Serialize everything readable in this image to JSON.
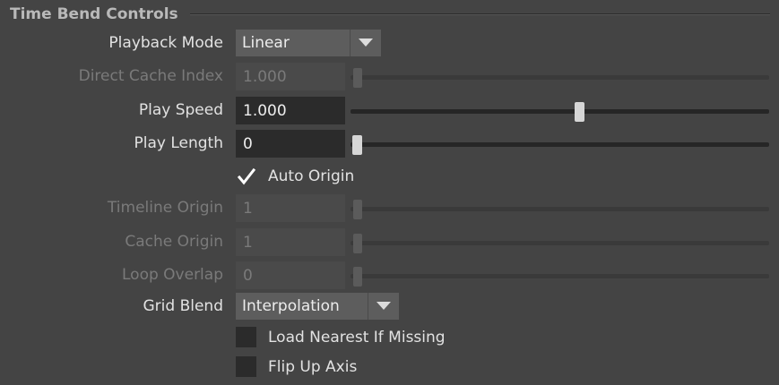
{
  "section": {
    "title": "Time Bend Controls"
  },
  "playback_mode": {
    "label": "Playback Mode",
    "value": "Linear"
  },
  "direct_cache_index": {
    "label": "Direct Cache Index",
    "value": "1.000",
    "slider_fraction": 0.0
  },
  "play_speed": {
    "label": "Play Speed",
    "value": "1.000",
    "slider_fraction": 0.55
  },
  "play_length": {
    "label": "Play Length",
    "value": "0",
    "slider_fraction": 0.0
  },
  "auto_origin": {
    "label": "Auto Origin",
    "checked": true
  },
  "timeline_origin": {
    "label": "Timeline Origin",
    "value": "1",
    "slider_fraction": 0.0
  },
  "cache_origin": {
    "label": "Cache Origin",
    "value": "1",
    "slider_fraction": 0.0
  },
  "loop_overlap": {
    "label": "Loop Overlap",
    "value": "0",
    "slider_fraction": 0.0
  },
  "grid_blend": {
    "label": "Grid Blend",
    "value": "Interpolation"
  },
  "load_nearest": {
    "label": "Load Nearest If Missing",
    "checked": false
  },
  "flip_up_axis": {
    "label": "Flip Up Axis",
    "checked": false
  },
  "icons": {
    "dropdown": "chevron-down-icon",
    "check": "check-icon"
  },
  "colors": {
    "background": "#444444",
    "field": "#2b2b2b",
    "thumb": "#d6d6d6",
    "text": "#e2e2e2",
    "disabled_text": "#7a7a7a"
  }
}
